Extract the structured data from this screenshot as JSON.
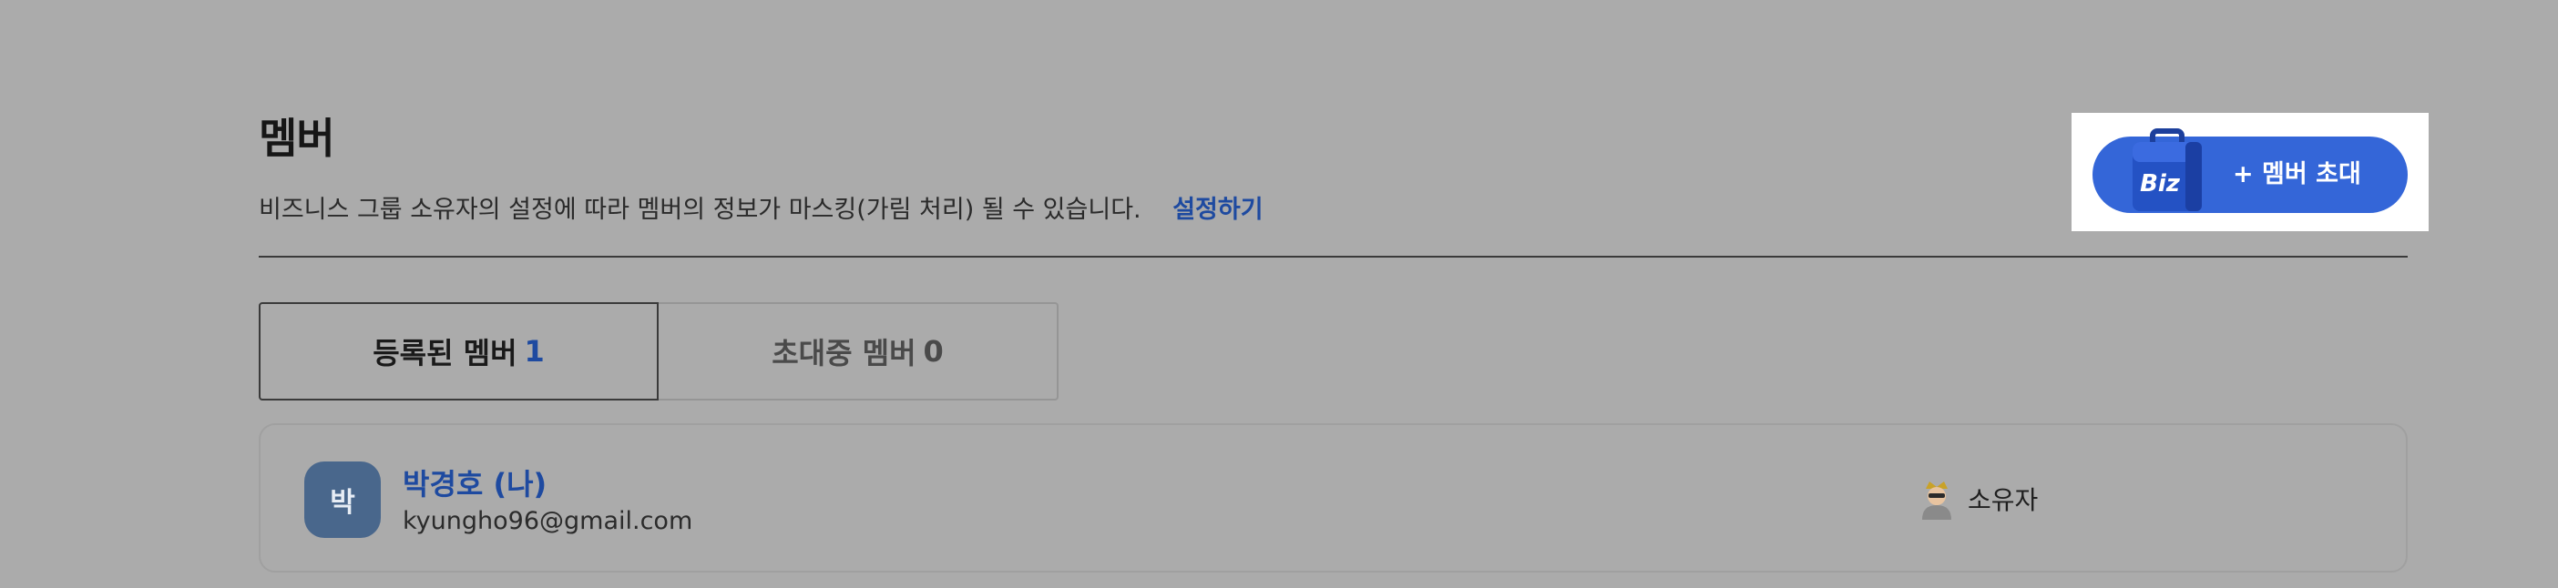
{
  "page": {
    "title": "멤버",
    "description": "비즈니스 그룹 소유자의 설정에 따라 멤버의 정보가 마스킹(가림 처리) 될 수 있습니다.",
    "settings_link": "설정하기"
  },
  "invite_button": {
    "label": "+ 멤버 초대",
    "icon_text": "Biz",
    "icon": "biz-briefcase-icon"
  },
  "tabs": [
    {
      "label": "등록된 멤버",
      "count": "1",
      "active": true
    },
    {
      "label": "초대중 멤버",
      "count": "0",
      "active": false
    }
  ],
  "members": [
    {
      "avatar_initial": "박",
      "name": "박경호 (나)",
      "email": "kyungho96@gmail.com",
      "role": "소유자",
      "role_icon": "owner-crown-icon"
    }
  ],
  "colors": {
    "background": "#ababab",
    "accent": "#1e4aa0",
    "button": "#3466d8",
    "avatar": "#49678c"
  }
}
